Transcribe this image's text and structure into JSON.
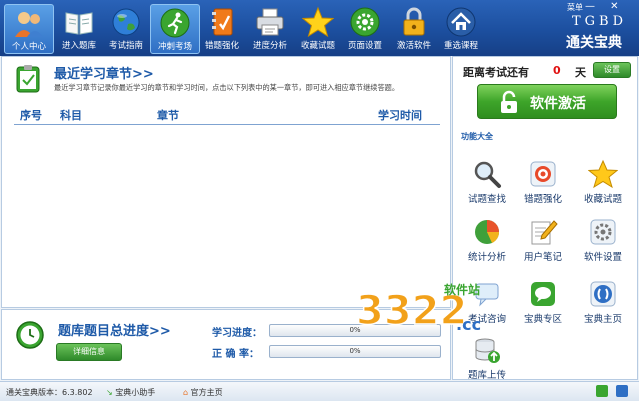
{
  "toolbar": {
    "items": [
      {
        "label": "个人中心",
        "icon": "user-icon",
        "active": true
      },
      {
        "label": "进入题库",
        "icon": "book-icon"
      },
      {
        "label": "考试指南",
        "icon": "globe-icon"
      },
      {
        "label": "冲刺考场",
        "icon": "runner-icon",
        "active": true
      },
      {
        "label": "错题强化",
        "icon": "notebook-icon"
      },
      {
        "label": "进度分析",
        "icon": "printer-icon"
      },
      {
        "label": "收藏试题",
        "icon": "star-icon"
      },
      {
        "label": "页面设置",
        "icon": "gear-icon"
      },
      {
        "label": "激活软件",
        "icon": "lock-icon"
      },
      {
        "label": "重选课程",
        "icon": "home-icon"
      }
    ],
    "menu_label": "菜单",
    "window_buttons": "— ✕",
    "logo_top": "TGBD",
    "logo_bottom": "通关宝典"
  },
  "recent": {
    "title": "最近学习章节>>",
    "description": "最近学习章节记录你最近学习的章节和学习时间，点击以下列表中的某一章节，即可进入相应章节继续答题。",
    "columns": [
      "序号",
      "科目",
      "章节",
      "学习时间"
    ]
  },
  "progress": {
    "title": "题库题目总进度>>",
    "detail_button": "详细信息",
    "study_label": "学习进度：",
    "study_value": "0%",
    "accuracy_label": "正 确 率：",
    "accuracy_value": "0%",
    "study_fraction": 0.0,
    "accuracy_fraction": 0.0
  },
  "exam": {
    "label": "距离考试还有",
    "days": "0",
    "unit": "天",
    "settings_button": "设置"
  },
  "activate_button": "软件激活",
  "functions": {
    "title": "功能大全",
    "items": [
      {
        "label": "试题查找",
        "icon": "magnifier-icon"
      },
      {
        "label": "错题强化",
        "icon": "target-icon"
      },
      {
        "label": "收藏试题",
        "icon": "star-icon"
      },
      {
        "label": "统计分析",
        "icon": "pie-chart-icon"
      },
      {
        "label": "用户笔记",
        "icon": "pencil-note-icon"
      },
      {
        "label": "软件设置",
        "icon": "settings-icon"
      },
      {
        "label": "考试咨询",
        "icon": "chat-icon"
      },
      {
        "label": "宝典专区",
        "icon": "speech-bubble-icon"
      },
      {
        "label": "宝典主页",
        "icon": "homepage-icon"
      },
      {
        "label": "题库上传",
        "icon": "database-upload-icon"
      }
    ]
  },
  "statusbar": {
    "version": "通关宝典版本：6.3.802",
    "helper": "宝典小助手",
    "homepage": "官方主页"
  },
  "watermark": {
    "number": "3322",
    "suffix": ".cc",
    "text": "软件站"
  },
  "colors": {
    "toolbar_blue": "#1c4f9f",
    "accent_green": "#3ea52a",
    "title_blue": "#1e5aa8",
    "days_red": "#e01010"
  }
}
